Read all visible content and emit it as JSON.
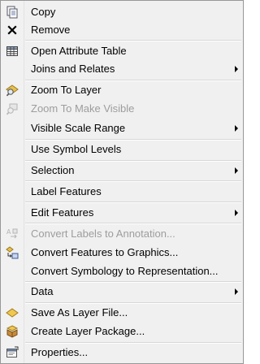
{
  "menu": {
    "copy": "Copy",
    "remove": "Remove",
    "open_attribute_table": "Open Attribute Table",
    "joins_and_relates": "Joins and Relates",
    "zoom_to_layer": "Zoom To Layer",
    "zoom_to_make_visible": "Zoom To Make Visible",
    "visible_scale_range": "Visible Scale Range",
    "use_symbol_levels": "Use Symbol Levels",
    "selection": "Selection",
    "label_features": "Label Features",
    "edit_features": "Edit Features",
    "convert_labels_to_annotation": "Convert Labels to Annotation...",
    "convert_features_to_graphics": "Convert Features to Graphics...",
    "convert_symbology_to_representation": "Convert Symbology to Representation...",
    "data": "Data",
    "save_as_layer_file": "Save As Layer File...",
    "create_layer_package": "Create Layer Package...",
    "properties": "Properties..."
  },
  "icons": {
    "copy": "copy-icon",
    "remove": "x-icon",
    "table": "table-icon",
    "zoom_to_layer": "zoom-to-layer-icon",
    "zoom_visible": "zoom-visible-icon",
    "convert_labels": "convert-labels-icon",
    "convert_features": "convert-features-icon",
    "save_layer": "layer-file-icon",
    "layer_package": "layer-package-icon",
    "properties": "properties-icon"
  },
  "colors": {
    "menu_background": "#f0f0f0",
    "disabled_text": "#9d9d9d",
    "layer_yellow": "#e8c04e"
  }
}
